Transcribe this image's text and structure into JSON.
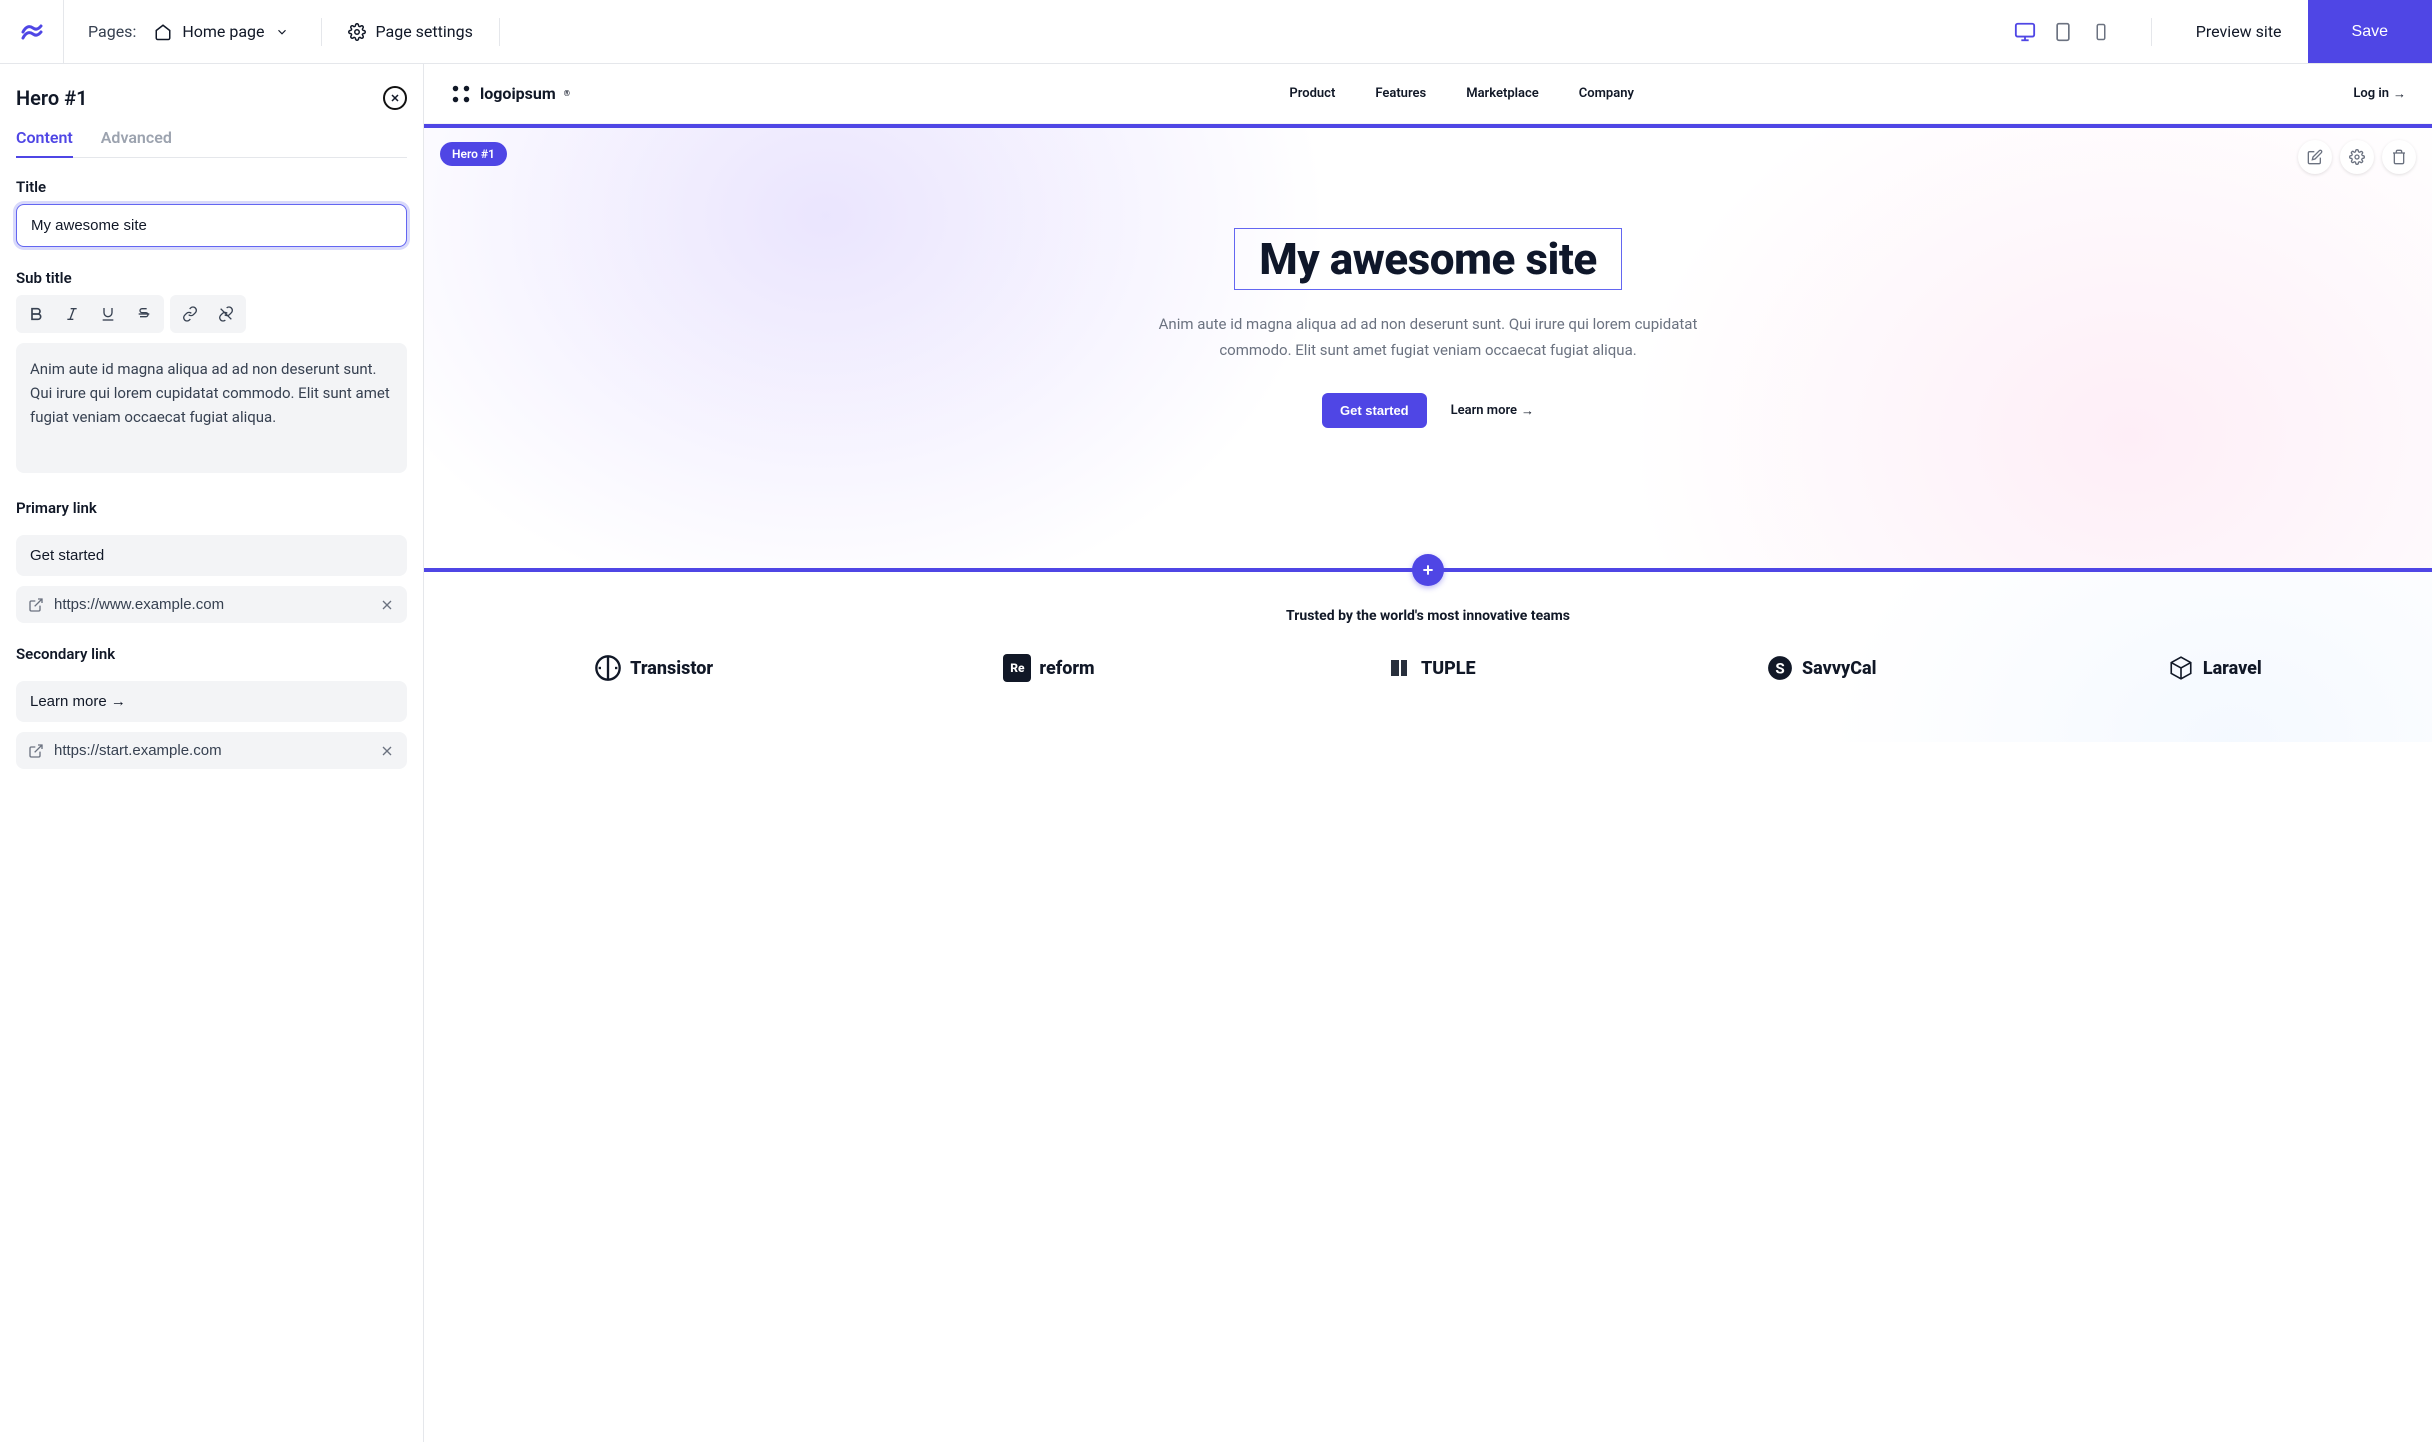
{
  "topbar": {
    "pages_label": "Pages:",
    "current_page": "Home page",
    "page_settings": "Page settings",
    "preview": "Preview site",
    "save": "Save"
  },
  "sidebar": {
    "panel_title": "Hero #1",
    "tabs": {
      "content": "Content",
      "advanced": "Advanced"
    },
    "title_label": "Title",
    "title_value": "My awesome site",
    "subtitle_label": "Sub title",
    "subtitle_value": "Anim aute id magna aliqua ad ad non deserunt sunt. Qui irure qui lorem cupidatat commodo. Elit sunt amet fugiat veniam occaecat fugiat aliqua.",
    "primary_link_label": "Primary link",
    "primary_link_text": "Get started",
    "primary_link_url": "https://www.example.com",
    "secondary_link_label": "Secondary link",
    "secondary_link_text": "Learn more →",
    "secondary_link_url": "https://start.example.com"
  },
  "preview": {
    "brand": "logoipsum",
    "nav": [
      "Product",
      "Features",
      "Marketplace",
      "Company"
    ],
    "login": "Log in",
    "block_tag": "Hero #1",
    "hero_title": "My awesome site",
    "hero_sub": "Anim aute id magna aliqua ad ad non deserunt sunt. Qui irure qui lorem cupidatat commodo. Elit sunt amet fugiat veniam occaecat fugiat aliqua.",
    "cta_primary": "Get started",
    "cta_secondary": "Learn more",
    "logos_heading": "Trusted by the world's most innovative teams",
    "logos": [
      "Transistor",
      "Reform",
      "TUPLE",
      "SavvyCal",
      "Laravel"
    ]
  }
}
